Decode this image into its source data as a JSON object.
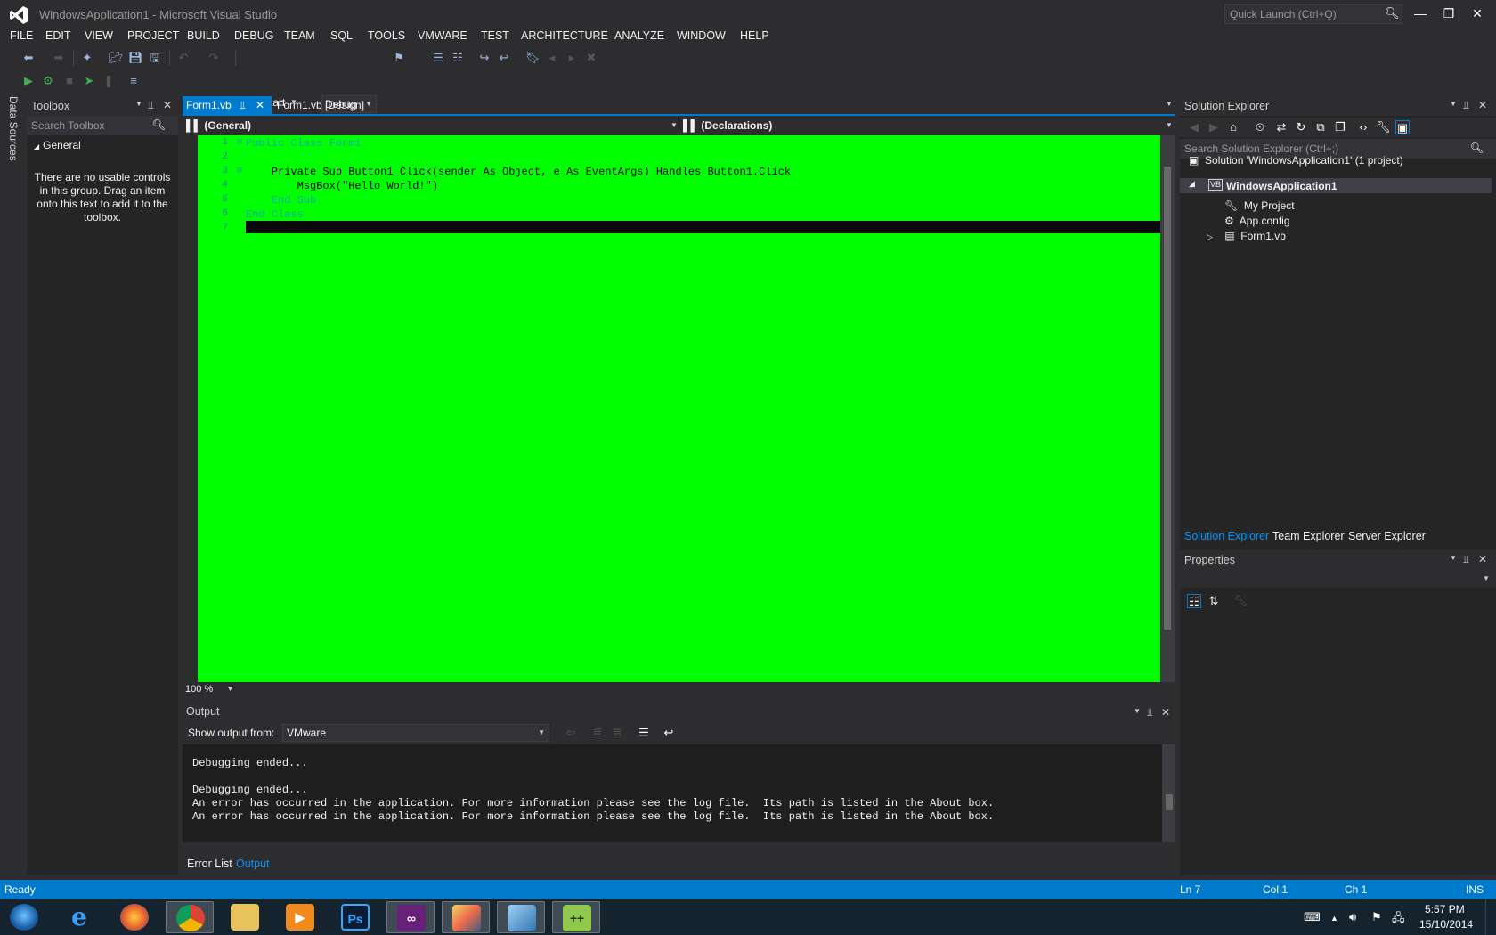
{
  "window": {
    "title": "WindowsApplication1 - Microsoft Visual Studio",
    "quick_launch_placeholder": "Quick Launch (Ctrl+Q)"
  },
  "menu": [
    "FILE",
    "EDIT",
    "VIEW",
    "PROJECT",
    "BUILD",
    "DEBUG",
    "TEAM",
    "SQL",
    "TOOLS",
    "VMWARE",
    "TEST",
    "ARCHITECTURE",
    "ANALYZE",
    "WINDOW",
    "HELP"
  ],
  "toolbar": {
    "start_label": "Start",
    "configuration": "Debug"
  },
  "left_tabs": {
    "data_sources": "Data Sources"
  },
  "toolbox": {
    "title": "Toolbox",
    "search_placeholder": "Search Toolbox",
    "group": "General",
    "empty_message": "There are no usable controls in this group. Drag an item onto this text to add it to the toolbox."
  },
  "editor": {
    "tabs": [
      {
        "label": "Form1.vb",
        "active": true
      },
      {
        "label": "Form1.vb [Design]",
        "active": false
      }
    ],
    "nav_left": "(General)",
    "nav_right": "(Declarations)",
    "line_numbers": [
      "1",
      "2",
      "3",
      "4",
      "5",
      "6",
      "7"
    ],
    "lines": [
      "Public Class Form1",
      "",
      "    Private Sub Button1_Click(sender As Object, e As EventArgs) Handles Button1.Click",
      "        MsgBox(\"Hello World!\")",
      "    End Sub",
      "End Class",
      ""
    ],
    "zoom": "100 %",
    "background_color": "#00ff00"
  },
  "output": {
    "title": "Output",
    "show_from_label": "Show output from:",
    "source": "VMware",
    "lines": [
      "Debugging ended...",
      "",
      "Debugging ended...",
      "An error has occurred in the application. For more information please see the log file.  Its path is listed in the About box.",
      "An error has occurred in the application. For more information please see the log file.  Its path is listed in the About box."
    ],
    "bottom_tabs": [
      "Error List",
      "Output"
    ]
  },
  "solution_explorer": {
    "title": "Solution Explorer",
    "search_placeholder": "Search Solution Explorer (Ctrl+;)",
    "solution": "Solution 'WindowsApplication1' (1 project)",
    "project": "WindowsApplication1",
    "items": [
      "My Project",
      "App.config",
      "Form1.vb"
    ],
    "tabs": [
      "Solution Explorer",
      "Team Explorer",
      "Server Explorer"
    ]
  },
  "properties": {
    "title": "Properties"
  },
  "status": {
    "text": "Ready",
    "ln": "Ln 7",
    "col": "Col 1",
    "ch": "Ch 1",
    "mode": "INS",
    "accent": "#007acc"
  },
  "taskbar": {
    "time": "5:57 PM",
    "date": "15/10/2014",
    "apps": [
      "start-orb-icon",
      "internet-explorer-icon",
      "firefox-icon",
      "chrome-icon",
      "file-explorer-icon",
      "media-player-icon",
      "photoshop-icon",
      "visual-studio-icon",
      "paint-icon",
      "virtualbox-icon",
      "notepad-plus-icon"
    ]
  }
}
